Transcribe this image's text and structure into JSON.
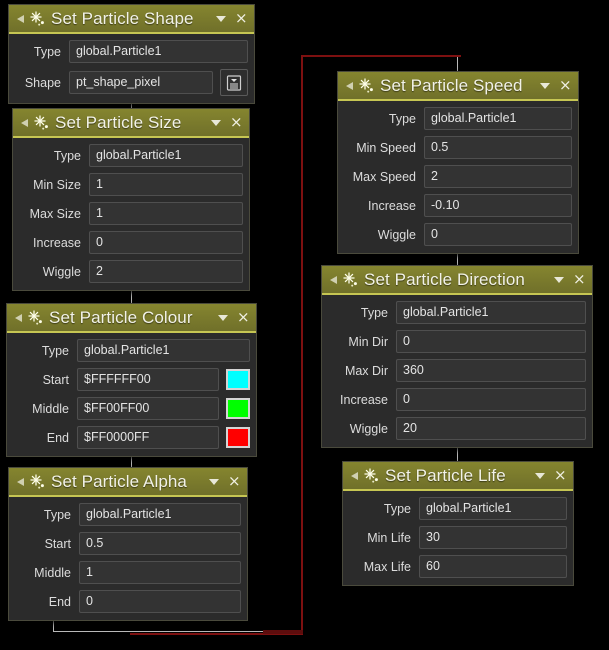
{
  "app": {
    "background": "#000000",
    "header_color": "#7b7b2c",
    "header_underline": "#c6c653",
    "node_bg": "#2b2b2b",
    "field_bg": "#333333",
    "wire_color": "#b9b9b9",
    "wire_red": "#7d1010"
  },
  "icons": {
    "collapse": "collapse-triangle-icon",
    "sparkle": "particle-sparkle-icon",
    "caret": "chevron-down-icon",
    "close": "×",
    "list": "list-menu-icon"
  },
  "nodes": [
    {
      "id": "set-particle-shape",
      "title": "Set Particle Shape",
      "label_width": 46,
      "rows": [
        {
          "label": "Type",
          "value": "global.Particle1"
        },
        {
          "label": "Shape",
          "value": "pt_shape_pixel",
          "button": "list-menu-icon"
        }
      ]
    },
    {
      "id": "set-particle-size",
      "title": "Set Particle Size",
      "label_width": 62,
      "rows": [
        {
          "label": "Type",
          "value": "global.Particle1"
        },
        {
          "label": "Min Size",
          "value": "1"
        },
        {
          "label": "Max Size",
          "value": "1"
        },
        {
          "label": "Increase",
          "value": "0"
        },
        {
          "label": "Wiggle",
          "value": "2"
        }
      ]
    },
    {
      "id": "set-particle-colour",
      "title": "Set Particle Colour",
      "label_width": 56,
      "rows": [
        {
          "label": "Type",
          "value": "global.Particle1"
        },
        {
          "label": "Start",
          "value": "$FFFFFF00",
          "swatch": "#00FFFF"
        },
        {
          "label": "Middle",
          "value": "$FF00FF00",
          "swatch": "#00FF00"
        },
        {
          "label": "End",
          "value": "$FF0000FF",
          "swatch": "#FF0000"
        }
      ]
    },
    {
      "id": "set-particle-alpha",
      "title": "Set Particle Alpha",
      "label_width": 56,
      "rows": [
        {
          "label": "Type",
          "value": "global.Particle1"
        },
        {
          "label": "Start",
          "value": "0.5"
        },
        {
          "label": "Middle",
          "value": "1"
        },
        {
          "label": "End",
          "value": "0"
        }
      ]
    },
    {
      "id": "set-particle-speed",
      "title": "Set Particle Speed",
      "label_width": 72,
      "rows": [
        {
          "label": "Type",
          "value": "global.Particle1"
        },
        {
          "label": "Min Speed",
          "value": "0.5"
        },
        {
          "label": "Max Speed",
          "value": "2"
        },
        {
          "label": "Increase",
          "value": "-0.10"
        },
        {
          "label": "Wiggle",
          "value": "0"
        }
      ]
    },
    {
      "id": "set-particle-direction",
      "title": "Set Particle Direction",
      "label_width": 60,
      "rows": [
        {
          "label": "Type",
          "value": "global.Particle1"
        },
        {
          "label": "Min Dir",
          "value": "0"
        },
        {
          "label": "Max Dir",
          "value": "360"
        },
        {
          "label": "Increase",
          "value": "0"
        },
        {
          "label": "Wiggle",
          "value": "20"
        }
      ]
    },
    {
      "id": "set-particle-life",
      "title": "Set Particle Life",
      "label_width": 62,
      "rows": [
        {
          "label": "Type",
          "value": "global.Particle1"
        },
        {
          "label": "Min Life",
          "value": "30"
        },
        {
          "label": "Max Life",
          "value": "60"
        }
      ]
    }
  ]
}
